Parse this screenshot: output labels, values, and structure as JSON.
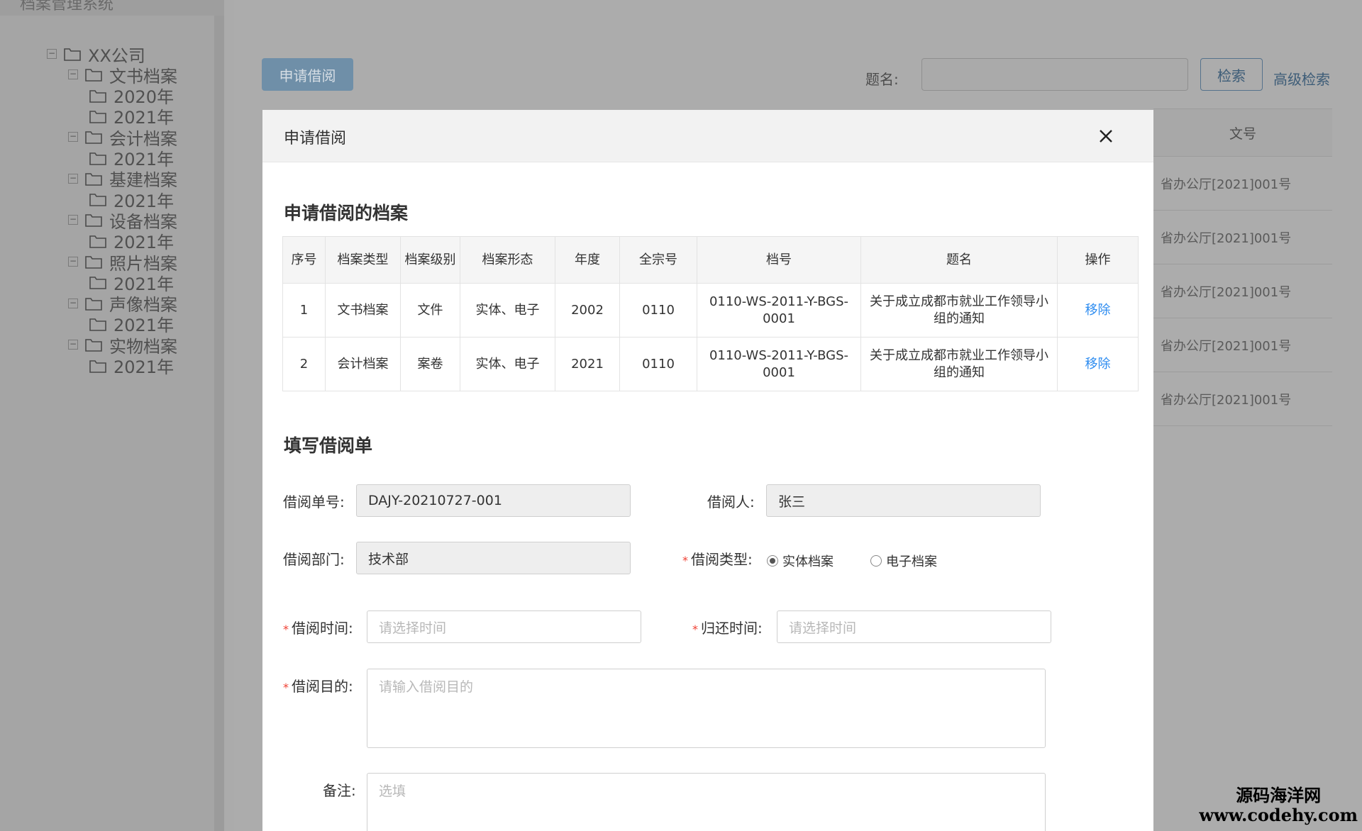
{
  "sidebar": {
    "header": "档案管理系统",
    "tree": [
      {
        "label": "XX公司",
        "level": 0,
        "expandable": true
      },
      {
        "label": "文书档案",
        "level": 1,
        "expandable": true
      },
      {
        "label": "2020年",
        "level": 2,
        "expandable": false
      },
      {
        "label": "2021年",
        "level": 2,
        "expandable": false
      },
      {
        "label": "会计档案",
        "level": 1,
        "expandable": true
      },
      {
        "label": "2021年",
        "level": 2,
        "expandable": false
      },
      {
        "label": "基建档案",
        "level": 1,
        "expandable": true
      },
      {
        "label": "2021年",
        "level": 2,
        "expandable": false
      },
      {
        "label": "设备档案",
        "level": 1,
        "expandable": true
      },
      {
        "label": "2021年",
        "level": 2,
        "expandable": false
      },
      {
        "label": "照片档案",
        "level": 1,
        "expandable": true
      },
      {
        "label": "2021年",
        "level": 2,
        "expandable": false
      },
      {
        "label": "声像档案",
        "level": 1,
        "expandable": true
      },
      {
        "label": "2021年",
        "level": 2,
        "expandable": false
      },
      {
        "label": "实物档案",
        "level": 1,
        "expandable": true
      },
      {
        "label": "2021年",
        "level": 2,
        "expandable": false
      }
    ]
  },
  "toolbar": {
    "apply_button": "申请借阅",
    "search_label": "题名:",
    "search_value": "",
    "search_button": "检索",
    "advanced_search": "高级检索"
  },
  "background_table": {
    "header": "文号",
    "rows": [
      "省办公厅[2021]001号",
      "省办公厅[2021]001号",
      "省办公厅[2021]001号",
      "省办公厅[2021]001号",
      "省办公厅[2021]001号"
    ]
  },
  "modal": {
    "title": "申请借阅",
    "section_files": "申请借阅的档案",
    "columns": [
      "序号",
      "档案类型",
      "档案级别",
      "档案形态",
      "年度",
      "全宗号",
      "档号",
      "题名",
      "操作"
    ],
    "rows": [
      {
        "no": "1",
        "type": "文书档案",
        "level": "文件",
        "form": "实体、电子",
        "year": "2002",
        "fonds": "0110",
        "code": "0110-WS-2011-Y-BGS-0001",
        "title": "关于成立成都市就业工作领导小组的通知",
        "action": "移除"
      },
      {
        "no": "2",
        "type": "会计档案",
        "level": "案卷",
        "form": "实体、电子",
        "year": "2021",
        "fonds": "0110",
        "code": "0110-WS-2011-Y-BGS-0001",
        "title": "关于成立成都市就业工作领导小组的通知",
        "action": "移除"
      }
    ],
    "section_form": "填写借阅单",
    "form": {
      "order_no_label": "借阅单号:",
      "order_no_value": "DAJY-20210727-001",
      "borrower_label": "借阅人:",
      "borrower_value": "张三",
      "dept_label": "借阅部门:",
      "dept_value": "技术部",
      "required_mark": "*",
      "type_label": "借阅类型:",
      "type_options": [
        "实体档案",
        "电子档案"
      ],
      "type_selected": "实体档案",
      "borrow_time_label": "借阅时间:",
      "borrow_time_placeholder": "请选择时间",
      "return_time_label": "归还时间:",
      "return_time_placeholder": "请选择时间",
      "purpose_label": "借阅目的:",
      "purpose_placeholder": "请输入借阅目的",
      "remark_label": "备注:",
      "remark_placeholder": "选填"
    }
  },
  "watermark": {
    "line1": "源码海洋网",
    "line2": "www.codehy.com"
  },
  "colors": {
    "link": "#2d8cf0",
    "required": "#f04134",
    "overlay_bg": "#ababab"
  }
}
